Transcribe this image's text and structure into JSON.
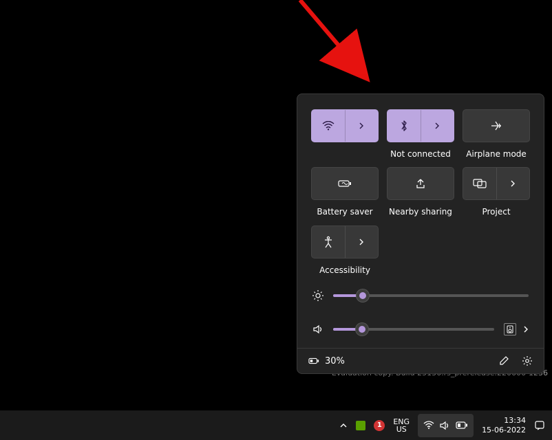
{
  "quick_settings": {
    "tiles": {
      "wifi": {
        "label": "",
        "active": true
      },
      "bluetooth": {
        "label": "Not connected",
        "active": true
      },
      "airplane": {
        "label": "Airplane mode",
        "active": false
      },
      "battery": {
        "label": "Battery saver",
        "active": false
      },
      "nearby": {
        "label": "Nearby sharing",
        "active": false
      },
      "project": {
        "label": "Project",
        "active": false
      },
      "accessibility": {
        "label": "Accessibility",
        "active": false
      }
    },
    "brightness_percent": 15,
    "volume_percent": 18,
    "footer": {
      "battery_text": "30%"
    }
  },
  "desktop": {
    "watermark": "Evaluation copy. Build 25136.rs_prerelease.220606-1236"
  },
  "taskbar": {
    "notification_count": "1",
    "lang_top": "ENG",
    "lang_bottom": "US",
    "time": "13:34",
    "date": "15-06-2022"
  },
  "colors": {
    "accent": "#bca7e0"
  }
}
